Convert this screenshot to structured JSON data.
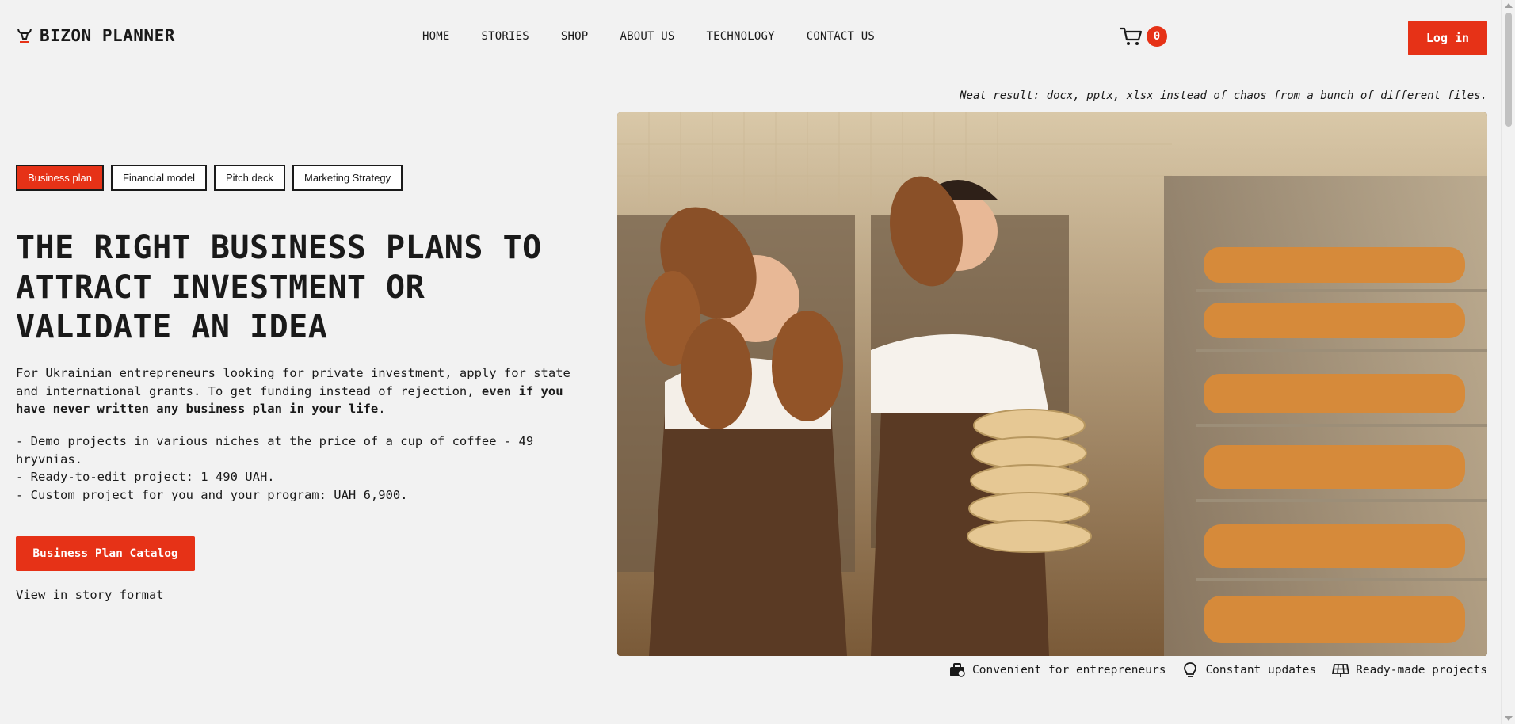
{
  "header": {
    "brand": "BIZON PLANNER",
    "nav": [
      "HOME",
      "STORIES",
      "SHOP",
      "ABOUT US",
      "TECHNOLOGY",
      "CONTACT US"
    ],
    "cart_count": "0",
    "login_label": "Log in"
  },
  "tagline": "Neat result: docx, pptx, xlsx instead of chaos from a bunch of different files.",
  "tabs": [
    "Business plan",
    "Financial model",
    "Pitch deck",
    "Marketing Strategy"
  ],
  "headline": "THE RIGHT BUSINESS PLANS TO ATTRACT INVESTMENT OR VALIDATE AN IDEA",
  "intro": {
    "text": "For Ukrainian entrepreneurs looking for private investment, apply for state and international grants. To get funding instead of rejection, ",
    "bold": "even if you have never written any business plan in your life",
    "end": "."
  },
  "pricing": [
    "- Demo projects in various niches at the price of a cup of coffee - 49 hryvnias.",
    "- Ready-to-edit project: 1 490 UAH.",
    "- Custom project for you and your program: UAH 6,900."
  ],
  "catalog_button": "Business Plan Catalog",
  "story_link": "View in story format",
  "features": [
    "Convenient for entrepreneurs",
    "Constant updates",
    "Ready-made projects"
  ],
  "colors": {
    "accent": "#e63217",
    "background": "#f2f2f2",
    "text": "#1a1a1a"
  }
}
